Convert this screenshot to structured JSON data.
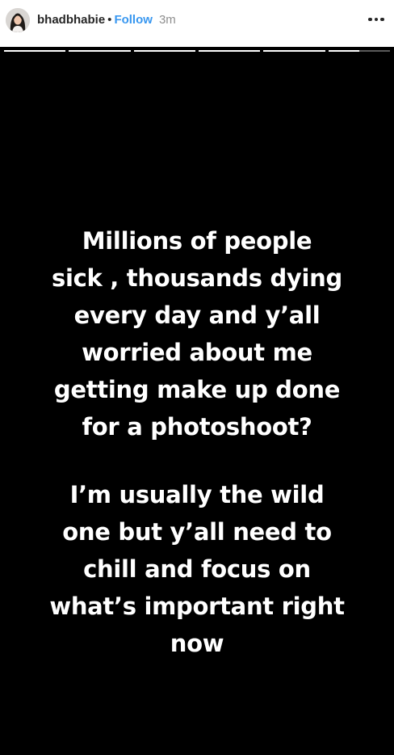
{
  "header": {
    "username": "bhadbhabie",
    "separator": "•",
    "follow_label": "Follow",
    "time_ago": "3m",
    "avatar_icon": "profile-avatar",
    "more_icon": "more-options-icon"
  },
  "progress": {
    "segments": [
      {
        "progress": 1
      },
      {
        "progress": 1
      },
      {
        "progress": 1
      },
      {
        "progress": 1
      },
      {
        "progress": 1
      },
      {
        "progress": 0.5
      }
    ],
    "active_color": "#ffffff",
    "inactive_color": "#5a5a5a"
  },
  "story": {
    "background_color": "#000000",
    "text_color": "#ffffff",
    "paragraphs": [
      [
        "Millions of people",
        "sick , thousands dying",
        "every day and y’all",
        "worried about me",
        "getting make up done",
        "for a photoshoot?"
      ],
      [
        "I’m usually the wild",
        "one but y’all need to",
        "chill and focus on",
        "what’s important right",
        "now"
      ]
    ]
  },
  "colors": {
    "follow": "#3897f0",
    "username": "#262626",
    "time": "#8e8e8e"
  }
}
